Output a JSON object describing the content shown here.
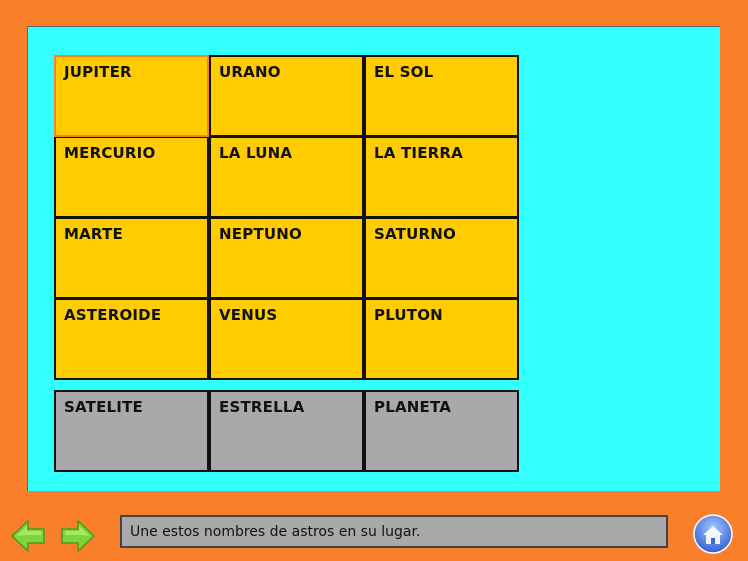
{
  "board": {
    "cells": [
      [
        "JUPITER",
        "URANO",
        "EL SOL"
      ],
      [
        "MERCURIO",
        "LA LUNA",
        "LA TIERRA"
      ],
      [
        "MARTE",
        "NEPTUNO",
        "SATURNO"
      ],
      [
        "ASTEROIDE",
        "VENUS",
        "PLUTON"
      ]
    ],
    "pieces": [
      "SATELITE",
      "ESTRELLA",
      "PLANETA"
    ]
  },
  "status": {
    "message": "Une estos nombres de astros en su lugar."
  },
  "nav": {
    "prev_icon": "left-arrow-icon",
    "next_icon": "right-arrow-icon",
    "home_icon": "home-icon"
  },
  "colors": {
    "background": "#fa7f2a",
    "stage": "#33ffff",
    "cell": "#ffcc00",
    "piece": "#a9a8ab"
  }
}
